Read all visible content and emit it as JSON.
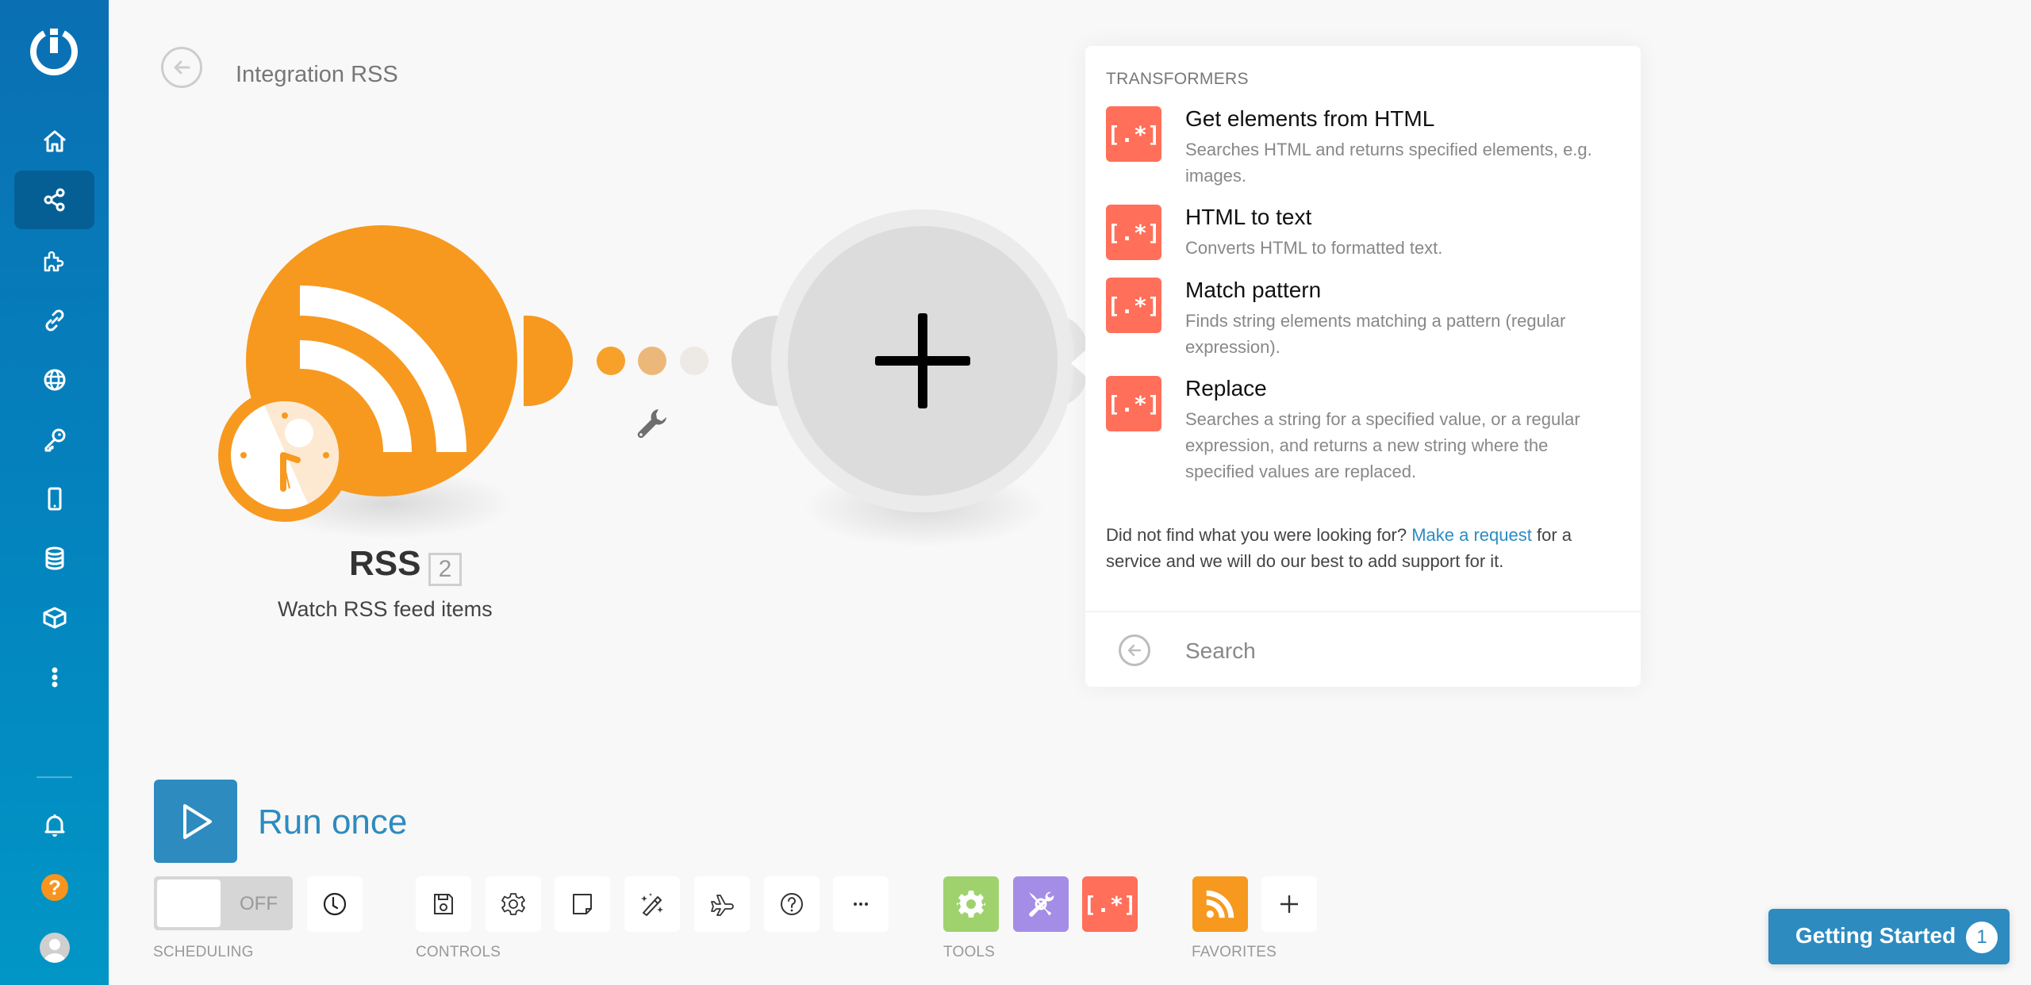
{
  "sidebar": {
    "logo": "integromat-logo-icon",
    "items": [
      {
        "name": "home",
        "icon": "home-icon",
        "active": false
      },
      {
        "name": "scenarios",
        "icon": "share-nodes-icon",
        "active": true
      },
      {
        "name": "templates",
        "icon": "puzzle-icon",
        "active": false
      },
      {
        "name": "connections",
        "icon": "link-icon",
        "active": false
      },
      {
        "name": "webhooks",
        "icon": "globe-icon",
        "active": false
      },
      {
        "name": "keys",
        "icon": "key-icon",
        "active": false
      },
      {
        "name": "devices",
        "icon": "mobile-icon",
        "active": false
      },
      {
        "name": "data-stores",
        "icon": "database-icon",
        "active": false
      },
      {
        "name": "data-structures",
        "icon": "cube-icon",
        "active": false
      },
      {
        "name": "more",
        "icon": "more-vertical-icon",
        "active": false
      }
    ],
    "bottom": {
      "notifications": "bell-icon",
      "help": "?",
      "profile": "avatar"
    }
  },
  "header": {
    "title": "Integration RSS"
  },
  "canvas": {
    "module": {
      "app": "RSS",
      "count": "2",
      "action": "Watch RSS feed items",
      "color": "#f7991f"
    },
    "connector_dots": [
      "#f7a12a",
      "#ecb87a",
      "#ede9e4"
    ],
    "add_module": "+"
  },
  "panel": {
    "section": "TRANSFORMERS",
    "items": [
      {
        "name": "Get elements from HTML",
        "desc": "Searches HTML and returns specified elements, e.g. images."
      },
      {
        "name": "HTML to text",
        "desc": "Converts HTML to formatted text."
      },
      {
        "name": "Match pattern",
        "desc": "Finds string elements matching a pattern (regular expression)."
      },
      {
        "name": "Replace",
        "desc": "Searches a string for a specified value, or a regular expression, and returns a new string where the specified values are replaced."
      }
    ],
    "icon_glyph": "[.*]",
    "icon_color": "#ff6f59",
    "footer_before": "Did not find what you were looking for? ",
    "footer_link": "Make a request",
    "footer_after": " for a service and we will do our best to add support for it.",
    "search_placeholder": "Search",
    "search_value": ""
  },
  "toolbar": {
    "run_label": "Run once",
    "toggle_state": "OFF",
    "groups": {
      "scheduling": "SCHEDULING",
      "controls": "CONTROLS",
      "tools": "TOOLS",
      "favorites": "FAVORITES"
    },
    "controls": [
      "save-icon",
      "settings-icon",
      "notes-icon",
      "auto-align-icon",
      "explain-flow-icon",
      "help-icon",
      "more-icon"
    ],
    "tools": [
      {
        "name": "flow-control",
        "color": "#9fd26d"
      },
      {
        "name": "tools",
        "color": "#a48de6"
      },
      {
        "name": "text-parser",
        "color": "#ff6f59"
      }
    ],
    "favorites": [
      {
        "name": "rss",
        "color": "#f7991f"
      }
    ]
  },
  "getting_started": {
    "label": "Getting Started",
    "count": "1",
    "color": "#2d8bbf"
  }
}
